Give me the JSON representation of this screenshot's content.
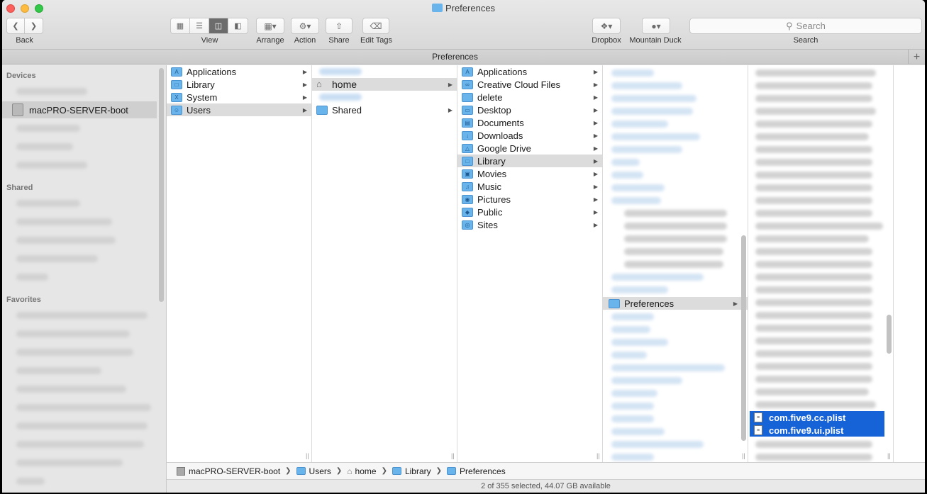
{
  "window": {
    "title": "Preferences",
    "tab_title": "Preferences"
  },
  "toolbar": {
    "back_label": "Back",
    "view_label": "View",
    "arrange_label": "Arrange",
    "action_label": "Action",
    "share_label": "Share",
    "edit_tags_label": "Edit Tags",
    "dropbox_label": "Dropbox",
    "mountain_duck_label": "Mountain Duck",
    "search_label": "Search",
    "search_placeholder": "Search"
  },
  "sidebar": {
    "devices_header": "Devices",
    "shared_header": "Shared",
    "favorites_header": "Favorites",
    "selected_device": "macPRO-SERVER-boot"
  },
  "columns": {
    "col1": [
      "Applications",
      "Library",
      "System",
      "Users"
    ],
    "col2": [
      "home",
      "Shared"
    ],
    "col3": [
      "Applications",
      "Creative Cloud Files",
      "delete",
      "Desktop",
      "Documents",
      "Downloads",
      "Google Drive",
      "Library",
      "Movies",
      "Music",
      "Pictures",
      "Public",
      "Sites"
    ],
    "col4_selected": "Preferences",
    "col5_selected": [
      "com.five9.cc.plist",
      "com.five9.ui.plist"
    ]
  },
  "pathbar": {
    "items": [
      "macPRO-SERVER-boot",
      "Users",
      "home",
      "Library",
      "Preferences"
    ]
  },
  "status": {
    "text": "2 of 355 selected, 44.07 GB available"
  },
  "colors": {
    "selection_blue": "#1662d7",
    "folder_blue": "#6ab4ec",
    "close_red": "#fc605c",
    "min_yellow": "#fdbc40",
    "max_green": "#34c84a"
  }
}
